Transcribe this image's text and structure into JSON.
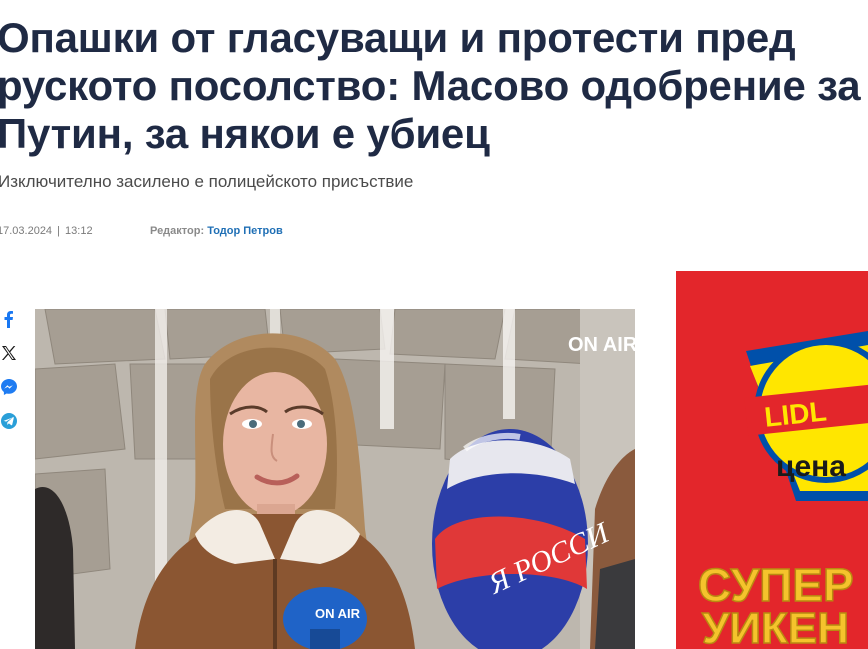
{
  "article": {
    "headline": "Опашки от гласуващи и протести пред руското посолство: Масово одобрение за Путин, за някои е убиец",
    "subtitle": "Изключително засилено е полицейското присъствие",
    "date": "17.03.2024",
    "time": "13:12",
    "editor_label": "Редактор:",
    "editor_name": "Тодор Петров"
  },
  "share": {
    "icons": [
      "facebook-icon",
      "x-twitter-icon",
      "messenger-icon",
      "telegram-icon"
    ]
  },
  "photo": {
    "watermark": "ON AIR",
    "mic_logo": "ON AIR",
    "balloon_text": "Я РОССИ"
  },
  "ad": {
    "brand": "LIDL",
    "badge": "цена",
    "promo_line1": "СУПЕР",
    "promo_line2": "УИКЕН"
  },
  "colors": {
    "headline": "#1f2a44",
    "link": "#1f6fb5",
    "ad_red": "#e3262b",
    "lidl_yellow": "#ffe600",
    "lidl_blue": "#0050aa"
  }
}
